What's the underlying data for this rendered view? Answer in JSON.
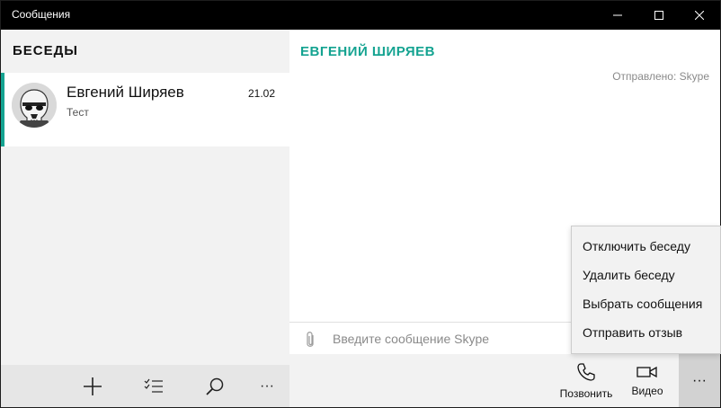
{
  "window": {
    "title": "Сообщения"
  },
  "sidebar": {
    "heading": "БЕСЕДЫ",
    "conversations": [
      {
        "name": "Евгений Ширяев",
        "preview": "Тест",
        "date": "21.02",
        "avatar_icon": "stormtrooper-avatar"
      }
    ],
    "toolbar": {
      "new_icon": "plus-icon",
      "select_icon": "checklist-icon",
      "search_icon": "search-icon",
      "more_label": "···"
    }
  },
  "chat": {
    "contact_name": "ЕВГЕНИЙ ШИРЯЕВ",
    "sent_via": "Отправлено: Skype",
    "input_placeholder": "Введите сообщение Skype",
    "actions": {
      "call_label": "Позвонить",
      "video_label": "Видео",
      "more_label": "···"
    }
  },
  "context_menu": {
    "items": [
      "Отключить беседу",
      "Удалить беседу",
      "Выбрать сообщения",
      "Отправить отзыв"
    ]
  },
  "colors": {
    "accent": "#14a391",
    "titlebar": "#000000",
    "sidebar_bg": "#f2f2f2"
  }
}
